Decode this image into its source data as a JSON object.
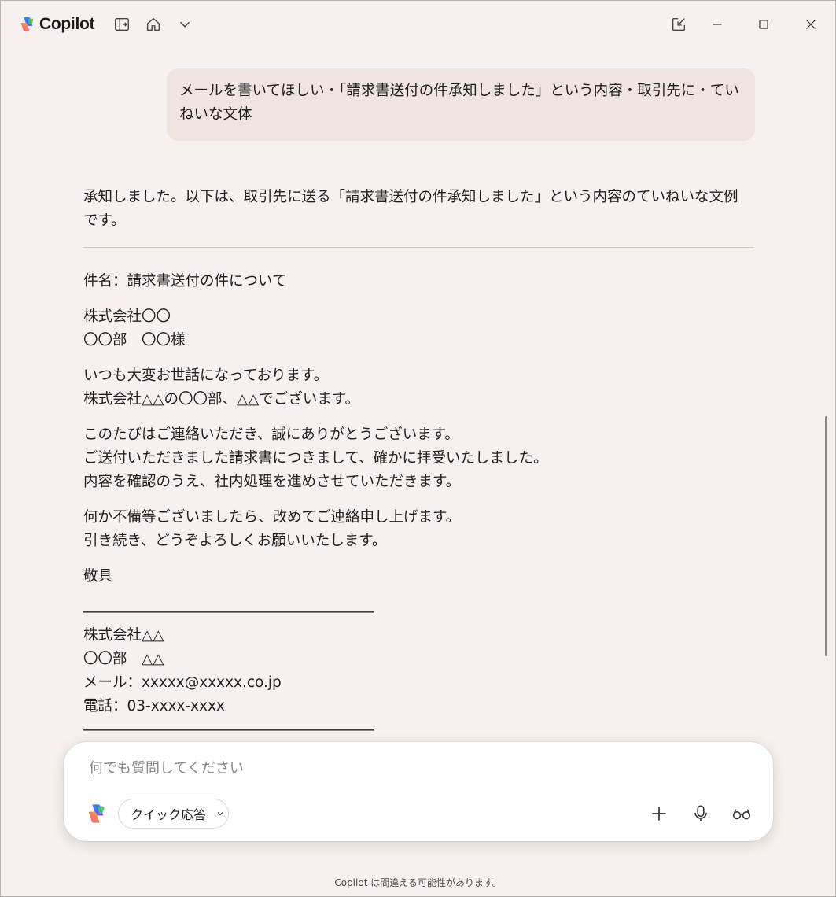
{
  "app": {
    "title": "Copilot",
    "icons": {
      "sidebar": "sidebar-toggle-icon",
      "home": "home-icon",
      "dropdown": "chevron-down-icon",
      "popout": "popout-icon",
      "minimize": "minimize-icon",
      "maximize": "maximize-icon",
      "close": "close-icon"
    }
  },
  "conversation": {
    "user_message": "メールを書いてほしい・「請求書送付の件承知しました」という内容・取引先に・ていねいな文体",
    "assistant_intro": "承知しました。以下は、取引先に送る「請求書送付の件承知しました」という内容のていねいな文例です。",
    "email": {
      "subject": "件名：請求書送付の件について",
      "recipient_company": "株式会社〇〇",
      "recipient_person": "〇〇部　〇〇様",
      "greeting_1": "いつも大変お世話になっております。",
      "greeting_2": "株式会社△△の〇〇部、△△でございます。",
      "body_1": "このたびはご連絡いただき、誠にありがとうございます。",
      "body_2": "ご送付いただきました請求書につきまして、確かに拝受いたしました。",
      "body_3": "内容を確認のうえ、社内処理を進めさせていただきます。",
      "closing_1": "何か不備等ございましたら、改めてご連絡申し上げます。",
      "closing_2": "引き続き、どうぞよろしくお願いいたします。",
      "sign_off": "敬具",
      "separator": "――――――――――――――――――――",
      "sender_company": "株式会社△△",
      "sender_person": "〇〇部　△△",
      "sender_mail": "メール：xxxxx@xxxxx.co.jp",
      "sender_phone": "電話：03-xxxx-xxxx"
    }
  },
  "composer": {
    "placeholder": "何でも質問してください",
    "mode_label": "クイック応答",
    "icons": {
      "add": "plus-icon",
      "mic": "microphone-icon",
      "vision": "glasses-icon"
    }
  },
  "footer": {
    "disclaimer": "Copilot は間違える可能性があります。"
  },
  "colors": {
    "background": "#f6f1ee",
    "user_bubble": "#efe4df",
    "composer": "#ffffff"
  }
}
